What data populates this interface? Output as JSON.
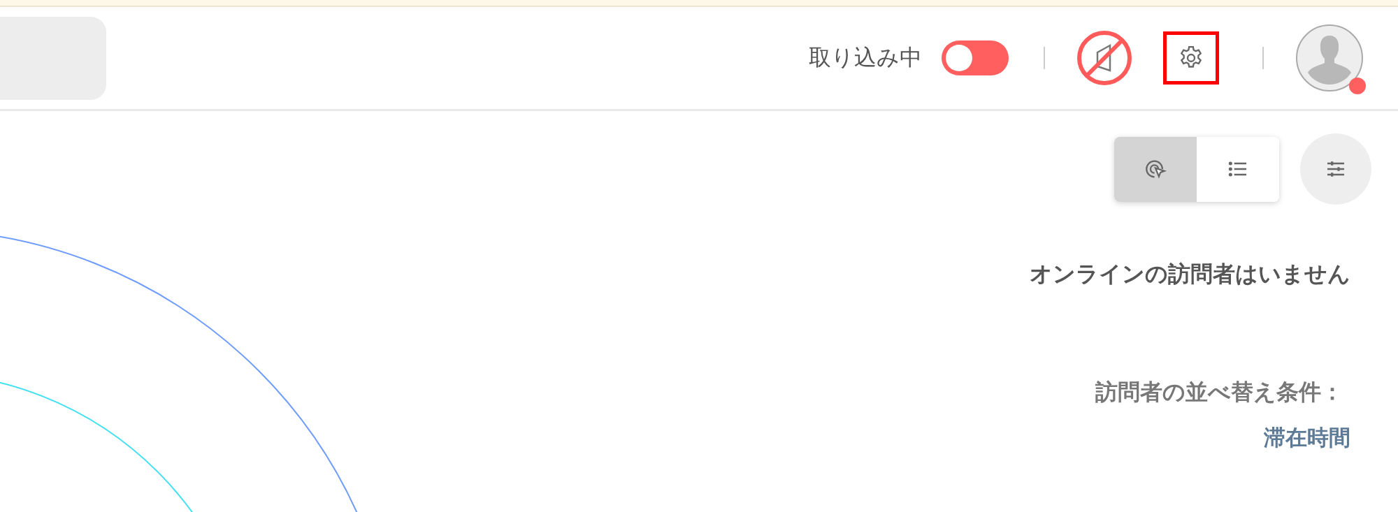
{
  "header": {
    "import_status": {
      "label": "取り込み中",
      "on": false
    },
    "sound": {
      "muted": true
    },
    "settings": {
      "highlighted": true
    },
    "avatar": {
      "status_dot": true
    }
  },
  "view_modes": [
    {
      "kind": "radar",
      "selected": true
    },
    {
      "kind": "list",
      "selected": false
    }
  ],
  "visitors": {
    "empty_message": "オンラインの訪問者はいません",
    "sort_label": "訪問者の並べ替え条件：",
    "sort_value": "滞在時間"
  }
}
